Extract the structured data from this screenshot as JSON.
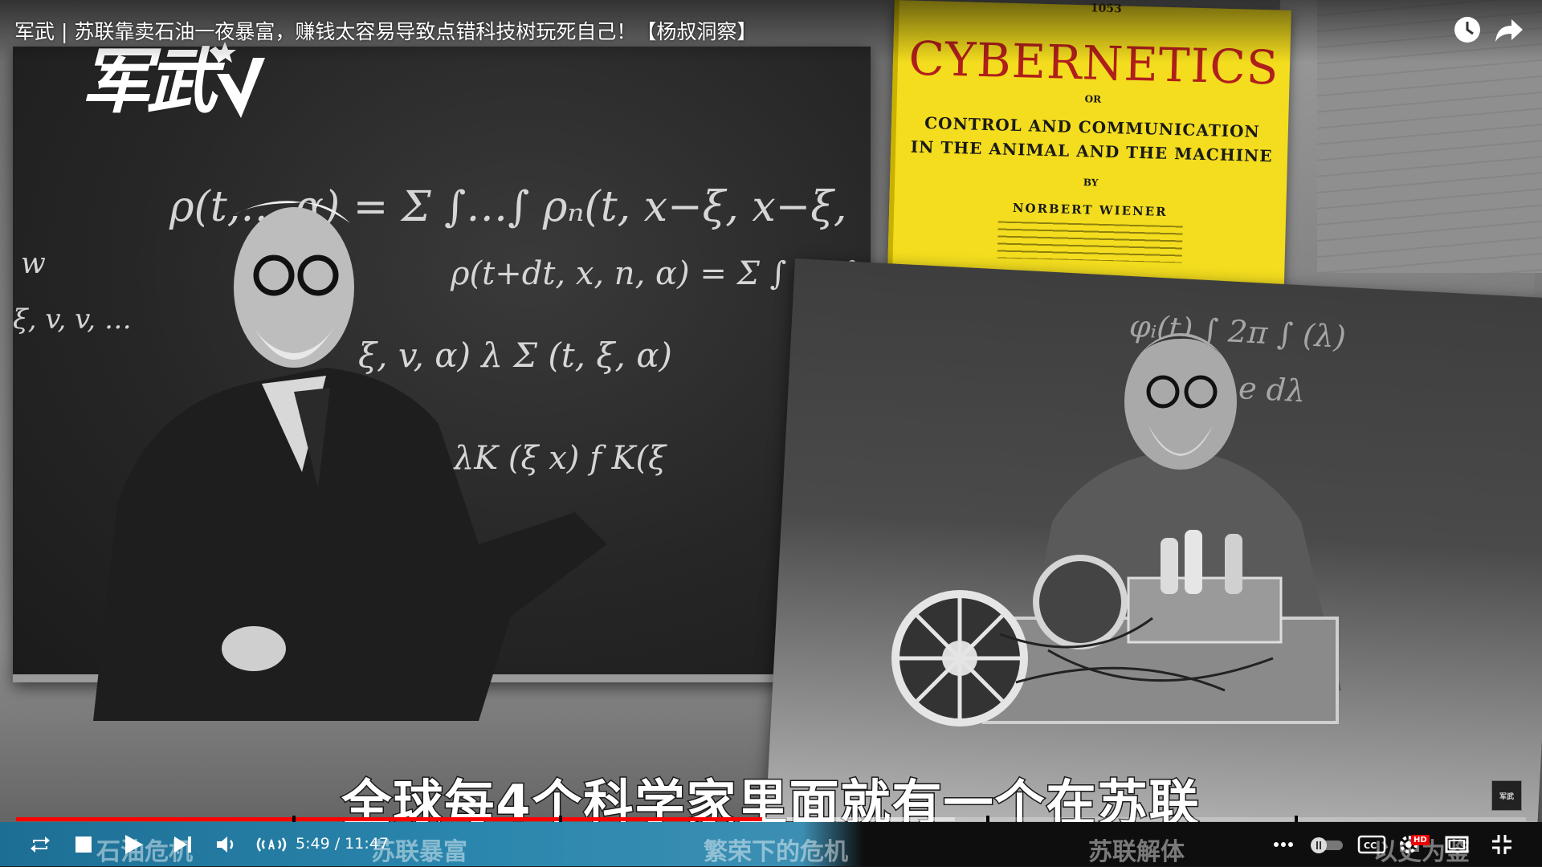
{
  "video": {
    "title": "军武 | 苏联靠卖石油一夜暴富，赚钱太容易导致点错科技树玩死自己！【杨叔洞察】",
    "logo_text": "军武",
    "subtitle": "全球每4个科学家里面就有一个在苏联",
    "watermark": "军武"
  },
  "book": {
    "number": "1053",
    "title": "CYBERNETICS",
    "or": "OR",
    "line1": "CONTROL AND COMMUNICATION",
    "line2": "IN THE ANIMAL AND THE MACHINE",
    "by": "BY",
    "author": "NORBERT WIENER"
  },
  "top_controls": {
    "watch_later_icon": "clock-icon",
    "share_icon": "share-arrow-icon"
  },
  "player": {
    "current_time": "5:49",
    "duration": "11:47",
    "time_display": "5:49 / 11:47",
    "progress_fraction": 0.494,
    "buffered_fraction": 0.622,
    "chapters": [
      "石油危机",
      "苏联暴富",
      "繁荣下的危机",
      "苏联解体",
      "以史为鉴"
    ],
    "controls": {
      "loop": "loop-icon",
      "stop": "stop-icon",
      "play": "play-icon",
      "next": "next-icon",
      "volume": "volume-icon",
      "mono": "audio-wave-icon",
      "more": "more-dots-icon",
      "autoplay": "autoplay-toggle-icon",
      "cc": "cc-icon",
      "quality": "settings-gear-icon",
      "quality_badge": "HD",
      "theater": "theater-mode-icon",
      "exit_fullscreen": "exit-fullscreen-icon"
    }
  },
  "colors": {
    "progress_played": "#ff0000",
    "book_yellow": "#f3dd1e",
    "book_title_red": "#b01f1c"
  }
}
